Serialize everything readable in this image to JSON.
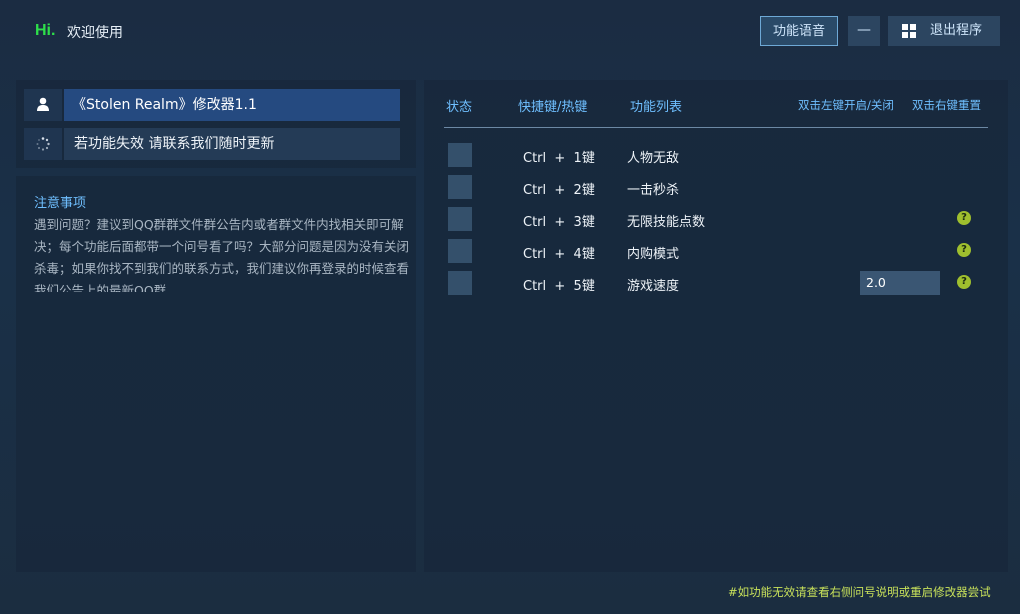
{
  "window": {
    "hi": "Hi.",
    "welcome": "欢迎使用"
  },
  "titlebar": {
    "voice_label": "功能语音",
    "minimize_label": "—",
    "exit_label": "退出程序"
  },
  "game": {
    "title": "《Stolen Realm》修改器1.1",
    "status_text": "若功能失效  请联系我们随时更新"
  },
  "notice": {
    "title": "注意事项",
    "body": "遇到问题？建议到QQ群群文件群公告内或者群文件内找相关即可解决；每个功能后面都带一个问号看了吗？大部分问题是因为没有关闭杀毒；如果你找不到我们的联系方式，我们建议你再登录的时候查看我们公告上的最新QQ群"
  },
  "table": {
    "headers": {
      "status": "状态",
      "hotkey": "快捷键/热键",
      "feature": "功能列表",
      "toggle_hint": "双击左键开启/关闭",
      "reset_hint": "双击右键重置"
    },
    "rows": [
      {
        "hotkey": "Ctrl  +  1键",
        "name": "人物无敌",
        "help": ""
      },
      {
        "hotkey": "Ctrl  +  2键",
        "name": "一击秒杀",
        "help": ""
      },
      {
        "hotkey": "Ctrl  +  3键",
        "name": "无限技能点数",
        "help": "?"
      },
      {
        "hotkey": "Ctrl  +  4键",
        "name": "内购模式",
        "help": "?"
      },
      {
        "hotkey": "Ctrl  +  5键",
        "name": "游戏速度",
        "help": "?"
      }
    ],
    "speed_value": "2.0"
  },
  "footer": {
    "text": "#如功能无效请查看右侧问号说明或重启修改器尝试"
  },
  "colors": {
    "accent": "#6fbfff",
    "hi_green": "#2ee04a",
    "help_badge": "#9fbf2e",
    "footer_text": "#c8e15a",
    "title_highlight": "#254a80"
  }
}
